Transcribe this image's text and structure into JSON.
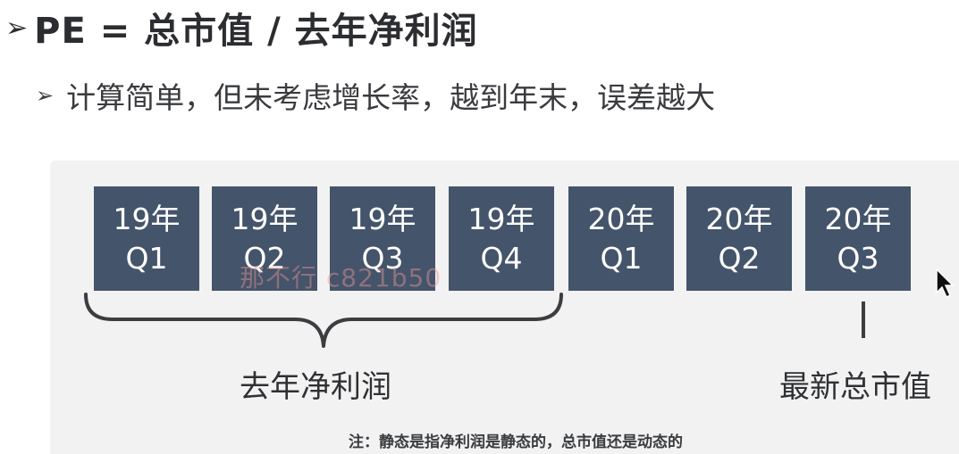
{
  "title": {
    "text": "PE = 总市值 / 去年净利润"
  },
  "subtitle": {
    "text": "计算简单，但未考虑增长率，越到年末，误差越大"
  },
  "quarters": [
    {
      "year": "19年",
      "q": "Q1"
    },
    {
      "year": "19年",
      "q": "Q2"
    },
    {
      "year": "19年",
      "q": "Q3"
    },
    {
      "year": "19年",
      "q": "Q4"
    },
    {
      "year": "20年",
      "q": "Q1"
    },
    {
      "year": "20年",
      "q": "Q2"
    },
    {
      "year": "20年",
      "q": "Q3"
    }
  ],
  "labels": {
    "last_year_profit": "去年净利润",
    "latest_market_cap": "最新总市值"
  },
  "note": "注：静态是指净利润是静态的，总市值还是动态的",
  "watermark": "那不行 c821b50",
  "colors": {
    "box_fill": "#44546a",
    "panel_bg": "#f2f2f2",
    "text": "#2f3033"
  }
}
